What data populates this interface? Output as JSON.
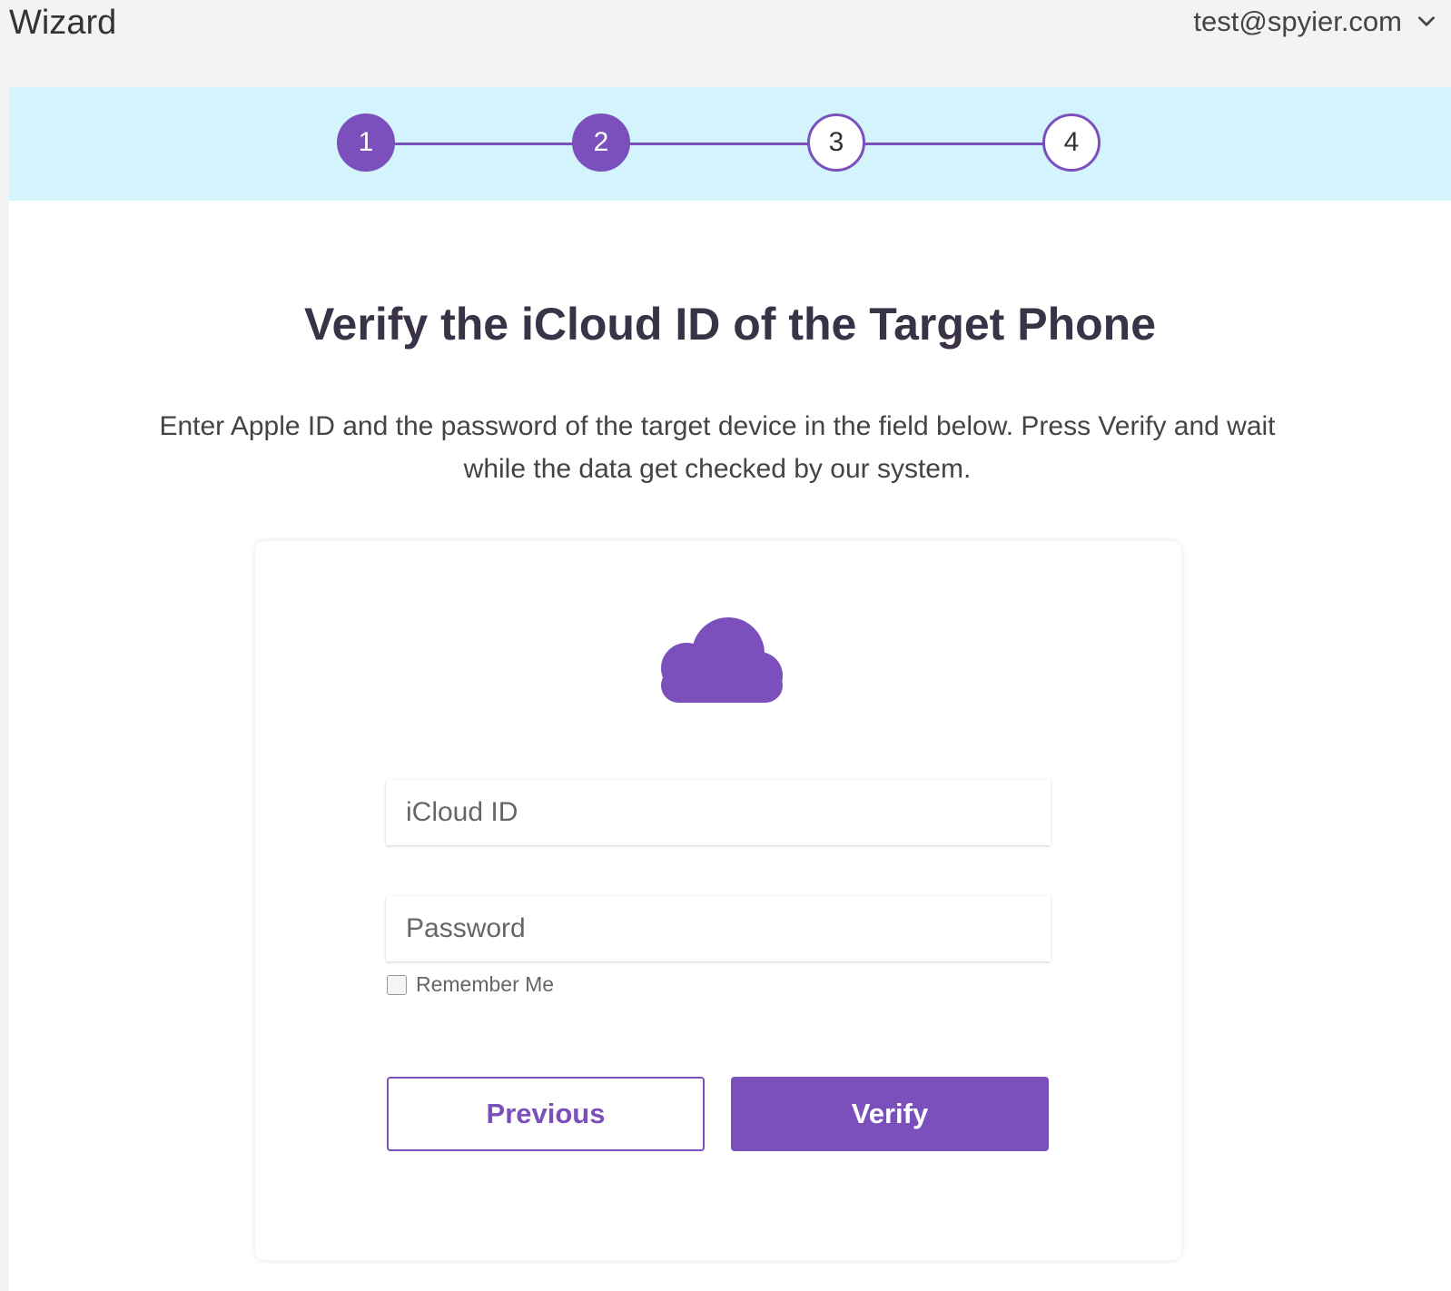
{
  "header": {
    "title": "Wizard",
    "account_email": "test@spyier.com"
  },
  "stepper": {
    "steps": [
      {
        "label": "1",
        "status": "done"
      },
      {
        "label": "2",
        "status": "done"
      },
      {
        "label": "3",
        "status": "todo"
      },
      {
        "label": "4",
        "status": "todo"
      }
    ],
    "current_step": 2
  },
  "main": {
    "heading": "Verify the iCloud ID of the Target Phone",
    "description": "Enter Apple ID and the password of the target device in the field below. Press Verify and wait while the data get checked by our system."
  },
  "form": {
    "icon": "cloud-icon",
    "icloud_field": {
      "placeholder": "iCloud ID",
      "value": ""
    },
    "password_field": {
      "placeholder": "Password",
      "value": ""
    },
    "remember_label": "Remember Me",
    "remember_checked": false,
    "previous_label": "Previous",
    "verify_label": "Verify"
  },
  "colors": {
    "accent": "#7b4fbc",
    "stepper_band": "#d3f4fc",
    "page_bg": "#f3f3f3"
  }
}
